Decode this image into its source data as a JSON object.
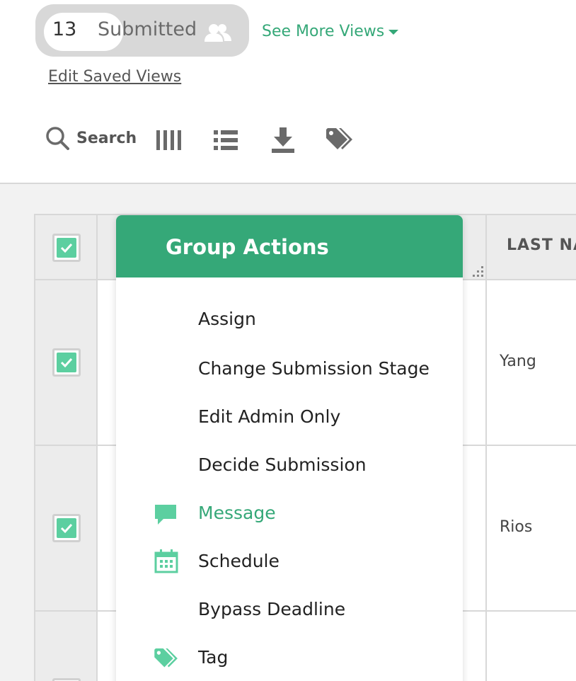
{
  "view": {
    "count": "13",
    "label": "Submitted",
    "icon": "people-icon",
    "see_more_label": "See More Views",
    "edit_saved_label": "Edit Saved Views"
  },
  "toolbar": {
    "search_label": "Search",
    "icons": [
      "search-icon",
      "columns-icon",
      "list-icon",
      "download-icon",
      "tag-icon"
    ]
  },
  "table": {
    "header": {
      "last_name": "LAST NA"
    },
    "rows": [
      {
        "last_name": "Yang"
      },
      {
        "last_name": "Rios"
      },
      {
        "last_name": ""
      }
    ]
  },
  "group_actions": {
    "title": "Group Actions",
    "items": [
      {
        "label": "Assign",
        "icon": ""
      },
      {
        "label": "Change Submission Stage",
        "icon": ""
      },
      {
        "label": "Edit Admin Only",
        "icon": ""
      },
      {
        "label": "Decide Submission",
        "icon": ""
      },
      {
        "label": "Message",
        "icon": "message-icon",
        "active": true
      },
      {
        "label": "Schedule",
        "icon": "calendar-icon"
      },
      {
        "label": "Bypass Deadline",
        "icon": ""
      },
      {
        "label": "Tag",
        "icon": "tag-icon"
      }
    ]
  },
  "colors": {
    "accent": "#35a878",
    "checkbox_fill": "#5ccfa0",
    "pill_bg": "#d8d8d8"
  }
}
